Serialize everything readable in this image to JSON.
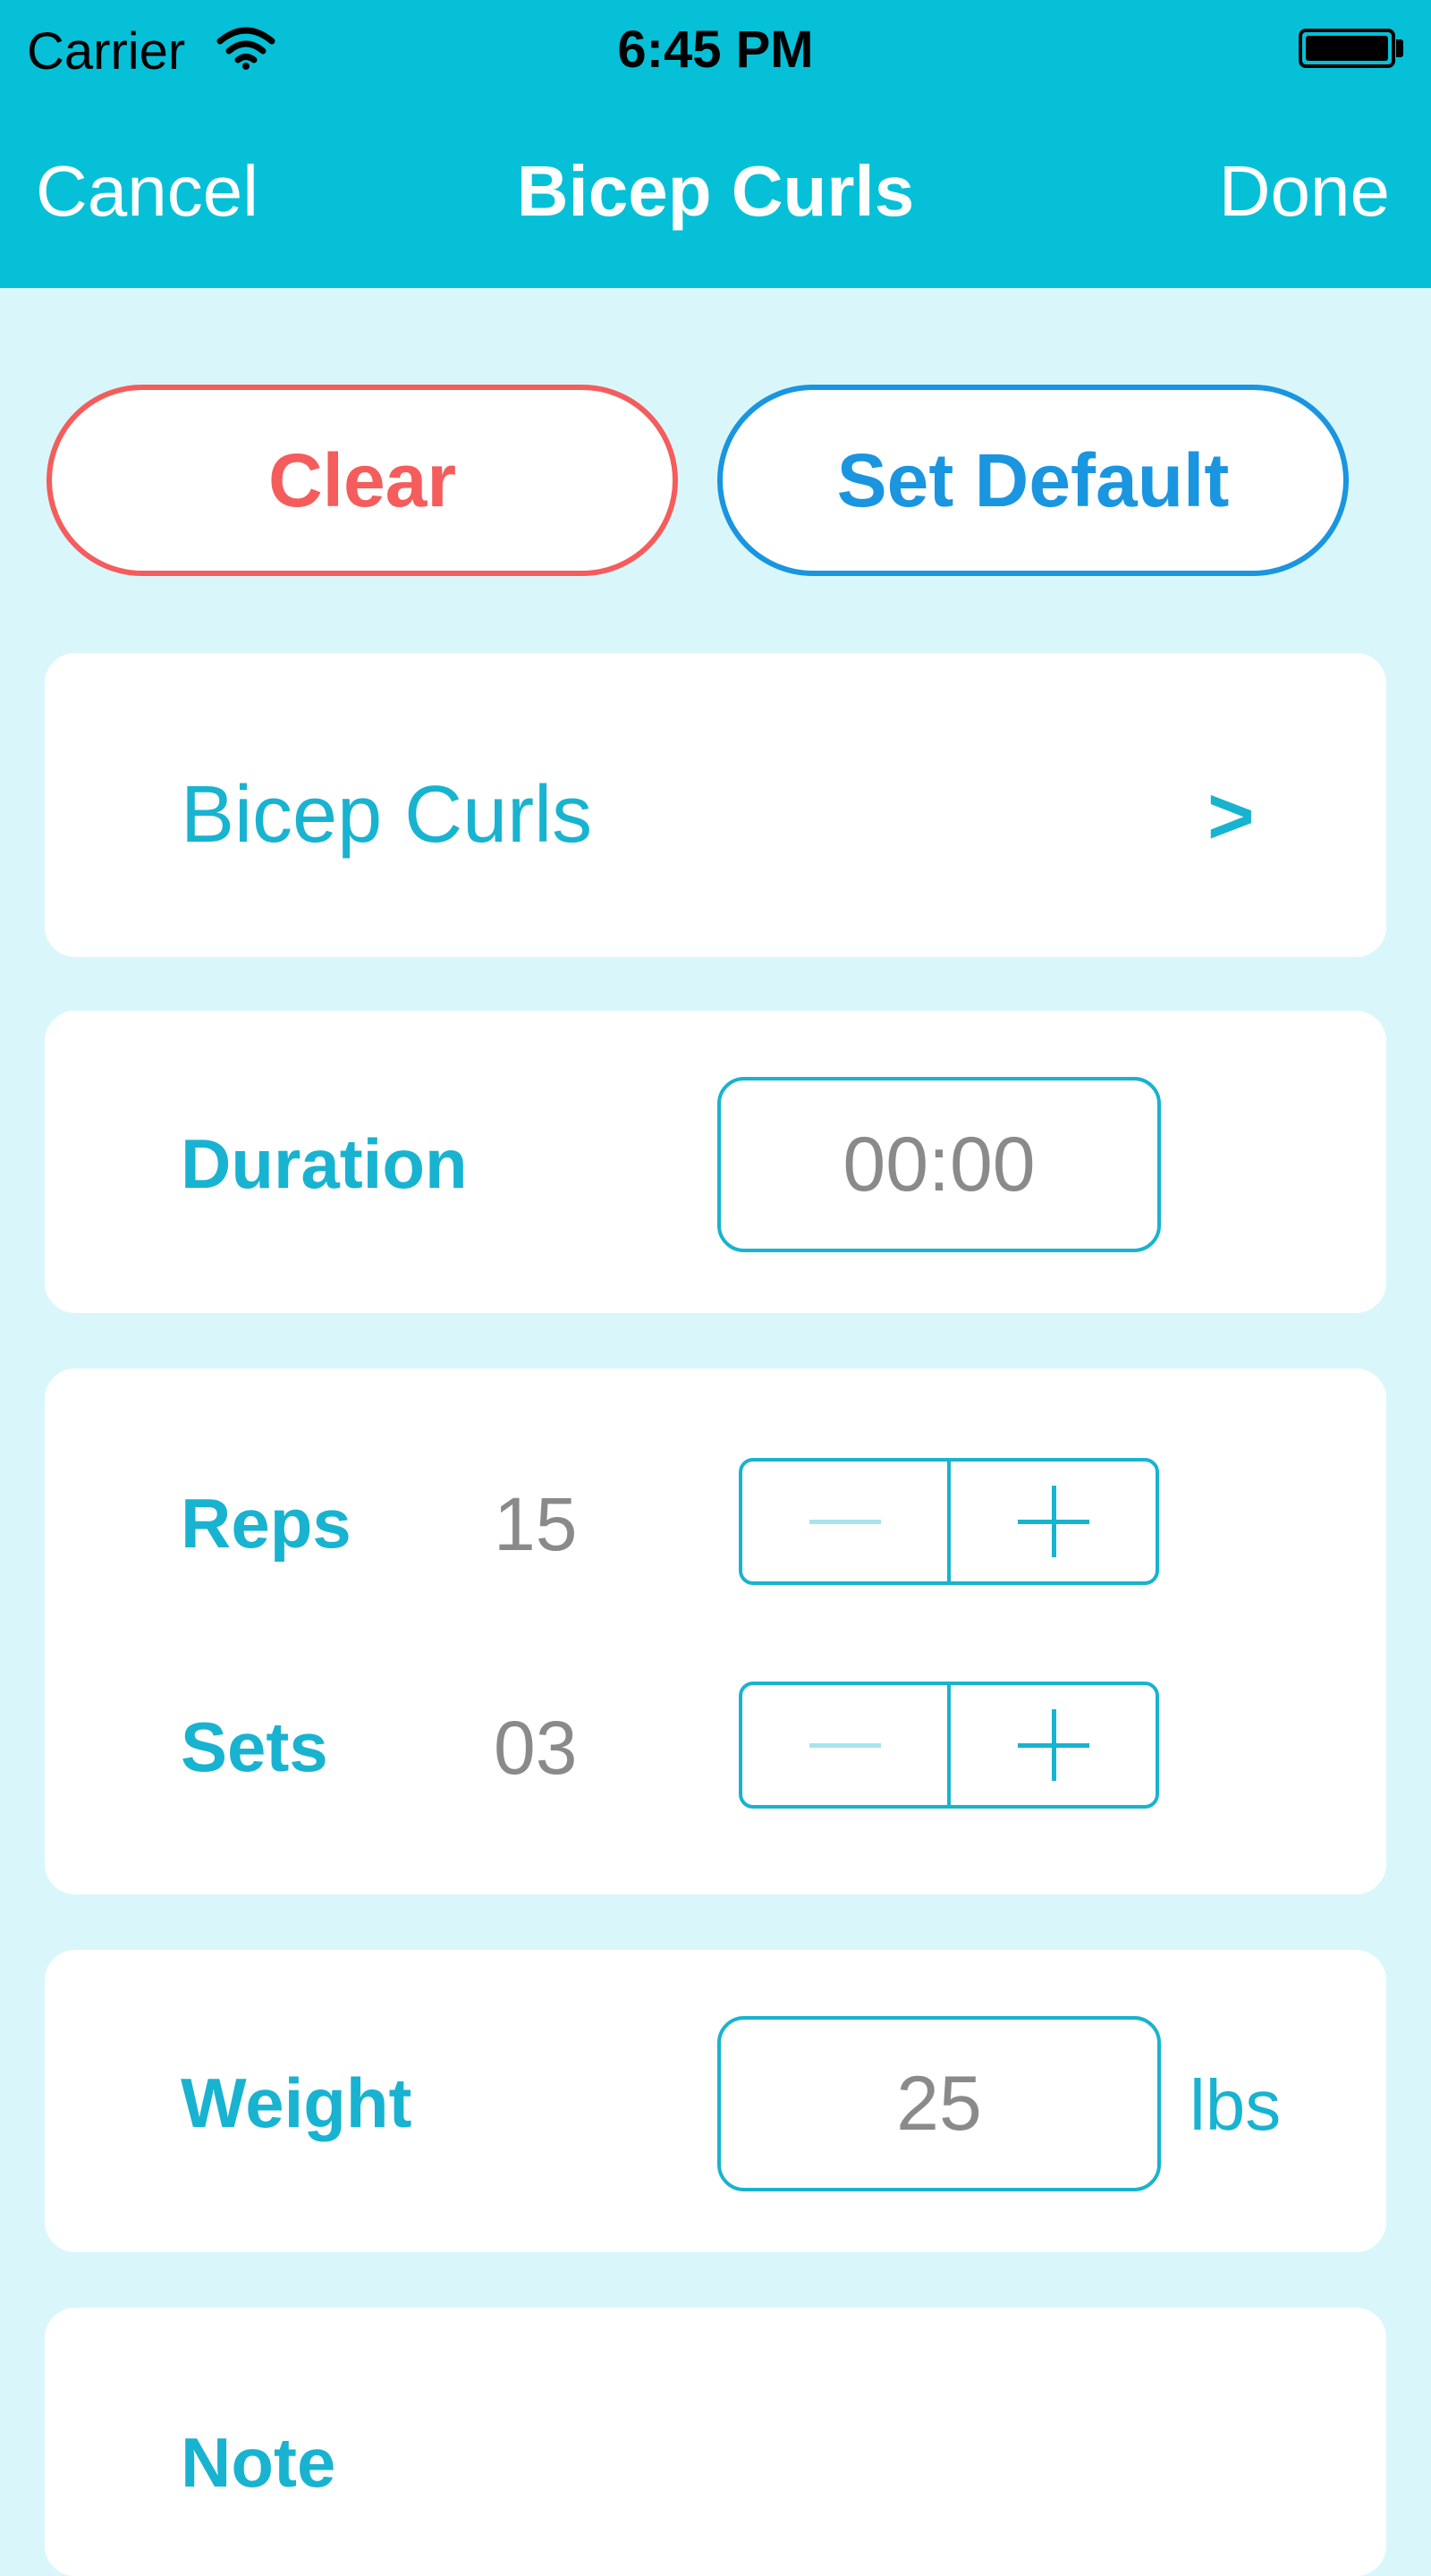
{
  "status_bar": {
    "carrier": "Carrier",
    "time": "6:45 PM"
  },
  "nav": {
    "cancel": "Cancel",
    "title": "Bicep Curls",
    "done": "Done"
  },
  "actions": {
    "clear": "Clear",
    "set_default": "Set Default"
  },
  "exercise": {
    "name": "Bicep Curls",
    "chevron": ">"
  },
  "duration": {
    "label": "Duration",
    "value": "00:00"
  },
  "reps": {
    "label": "Reps",
    "value": "15"
  },
  "sets": {
    "label": "Sets",
    "value": "03"
  },
  "weight": {
    "label": "Weight",
    "value": "25",
    "unit": "lbs"
  },
  "note": {
    "label": "Note"
  },
  "icons": [
    "wifi-icon",
    "battery-icon",
    "chevron-right-icon",
    "minus-icon",
    "plus-icon"
  ],
  "colors": {
    "header": "#06c0d8",
    "background": "#d9f7fb",
    "accent": "#18b3d0",
    "danger": "#f55c5c",
    "primary": "#1a95e0"
  }
}
